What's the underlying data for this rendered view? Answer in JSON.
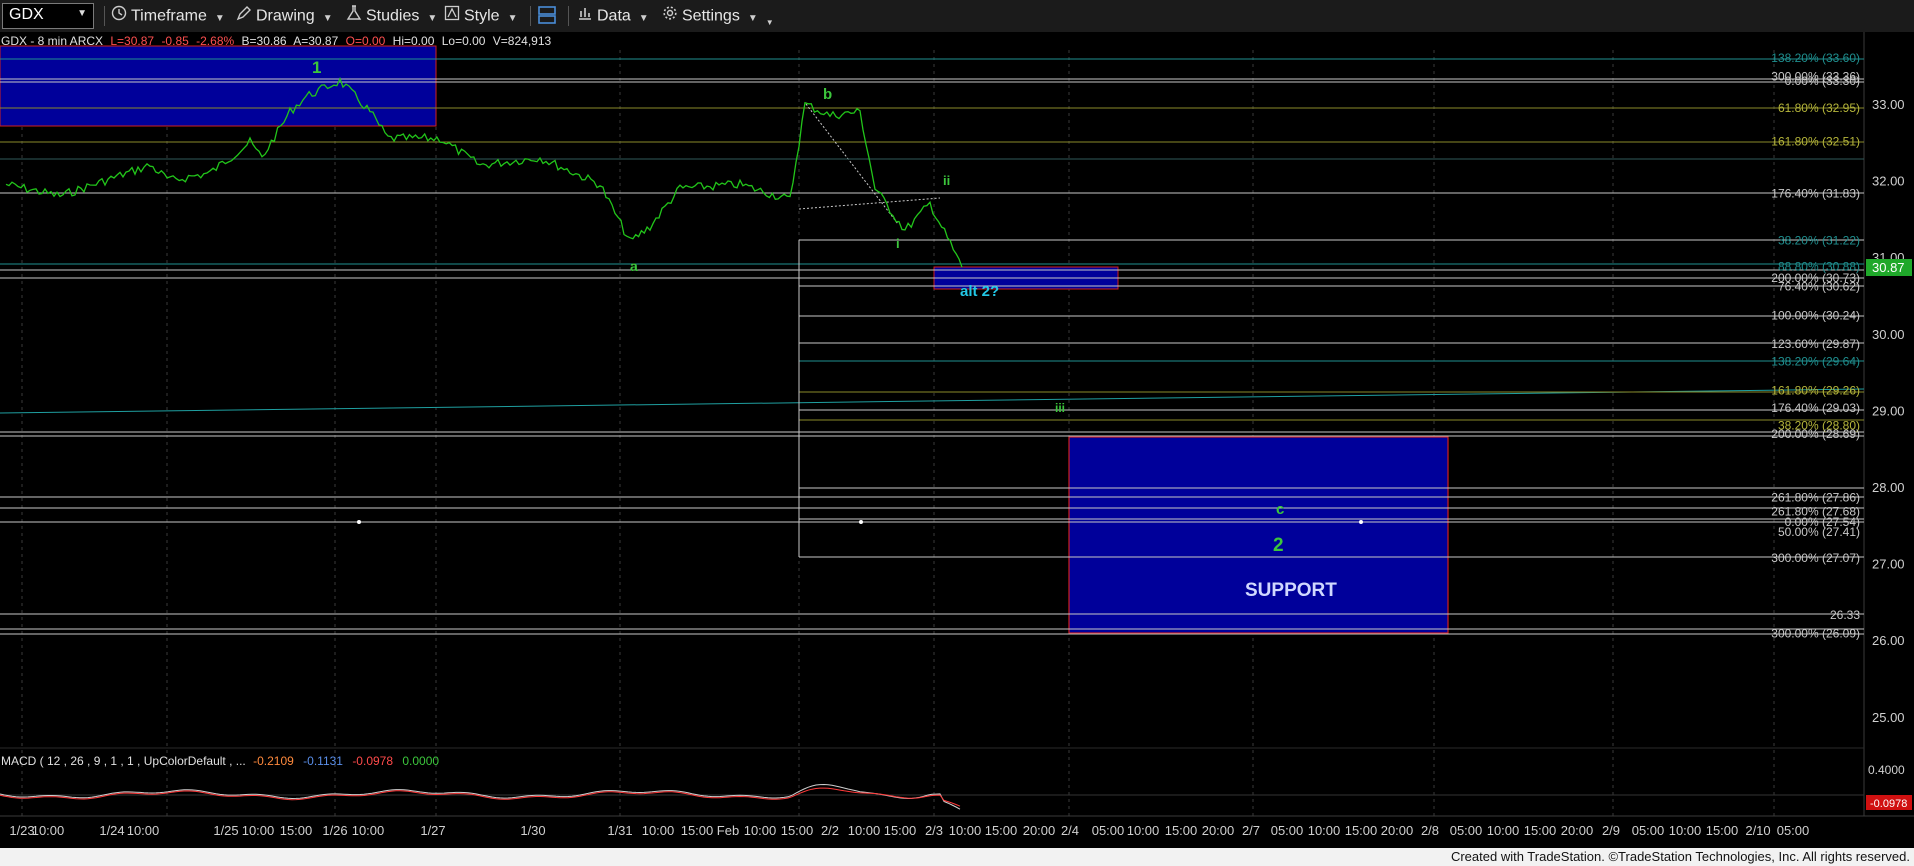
{
  "toolbar": {
    "symbol": "GDX",
    "items": [
      "Timeframe",
      "Drawing",
      "Studies",
      "Style",
      "Data",
      "Settings"
    ]
  },
  "header": {
    "symbol_info": "GDX - 8 min  ARCX",
    "last": "L=30.87",
    "change": "-0.85",
    "change_pct": "-2.68%",
    "bid": "B=30.86",
    "ask": "A=30.87",
    "open": "O=0.00",
    "hi": "Hi=0.00",
    "lo": "Lo=0.00",
    "vol": "V=824,913"
  },
  "colors": {
    "price_line": "#22c51a",
    "bid_color": "#ff4a4a",
    "last_badge": "#1fa82a",
    "box_blue": "#00009a",
    "box_border": "#d02020",
    "wave_label": "#3cc63c",
    "alt_label": "#22c8e6"
  },
  "price_axis": {
    "ticks": [
      "33.00",
      "32.00",
      "31.00",
      "30.00",
      "29.00",
      "28.00",
      "27.00",
      "26.00",
      "25.00"
    ],
    "last_price": "30.87"
  },
  "time_axis": {
    "labels": [
      "1/23",
      "10:00",
      "1/24",
      "10:00",
      "1/25",
      "10:00",
      "15:00",
      "1/26",
      "10:00",
      "1/27",
      "1/30",
      "1/31",
      "10:00",
      "15:00",
      "Feb",
      "10:00",
      "15:00",
      "2/2",
      "10:00",
      "15:00",
      "2/3",
      "10:00",
      "15:00",
      "20:00",
      "2/4",
      "05:00",
      "10:00",
      "15:00",
      "20:00",
      "2/7",
      "05:00",
      "10:00",
      "15:00",
      "20:00",
      "2/8",
      "05:00",
      "10:00",
      "15:00",
      "20:00",
      "2/9",
      "05:00",
      "10:00",
      "15:00",
      "2/10",
      "05:00"
    ]
  },
  "fib_labels": [
    {
      "text": "138.20% (33.60)",
      "color": "#1f8f8f"
    },
    {
      "text": "300.00% (33.36)",
      "color": "#c8c8c8"
    },
    {
      "text": "0.00% (33.30)",
      "color": "#c8c8c8"
    },
    {
      "text": "61.80% (32.95)",
      "color": "#b5b53a"
    },
    {
      "text": "161.80% (32.51)",
      "color": "#b5b53a"
    },
    {
      "text": "176.40% (31.83)",
      "color": "#c8c8c8"
    },
    {
      "text": "38.20% (31.22)",
      "color": "#1f8f8f"
    },
    {
      "text": "88.80% (30.88)",
      "color": "#1f8f8f"
    },
    {
      "text": "200.00% (30.73)",
      "color": "#c8c8c8"
    },
    {
      "text": "76.40% (30.62)",
      "color": "#c8c8c8"
    },
    {
      "text": "100.00% (30.24)",
      "color": "#c8c8c8"
    },
    {
      "text": "123.60% (29.87)",
      "color": "#c8c8c8"
    },
    {
      "text": "138.20% (29.64)",
      "color": "#1f8f8f"
    },
    {
      "text": "161.80% (29.26)",
      "color": "#b5b53a"
    },
    {
      "text": "176.40% (29.03)",
      "color": "#c8c8c8"
    },
    {
      "text": "38.20% (28.80)",
      "color": "#b5b53a"
    },
    {
      "text": "200.00% (28.69)",
      "color": "#c8c8c8"
    },
    {
      "text": "261.80% (27.86)",
      "color": "#c8c8c8"
    },
    {
      "text": "261.80% (27.68)",
      "color": "#c8c8c8"
    },
    {
      "text": "0.00% (27.54)",
      "color": "#c8c8c8"
    },
    {
      "text": "50.00% (27.41)",
      "color": "#c8c8c8"
    },
    {
      "text": "300.00% (27.07)",
      "color": "#c8c8c8"
    },
    {
      "text": "26.33",
      "color": "#c8c8c8"
    },
    {
      "text": "300.00% (26.09)",
      "color": "#c8c8c8"
    }
  ],
  "wave_labels": {
    "w1": "1",
    "a": "a",
    "b": "b",
    "i": "i",
    "ii": "ii",
    "iii": "iii",
    "c": "c",
    "w2": "2",
    "alt": "alt 2?",
    "support": "SUPPORT"
  },
  "macd": {
    "label": "MACD ( 12 , 26 , 9 , 1 , 1 , UpColorDefault , ...",
    "v1": "-0.2109",
    "v2": "-0.1131",
    "v3": "-0.0978",
    "v4": "0.0000",
    "axis_top": "0.4000",
    "axis_bottom": "-0.0978"
  },
  "footer": "Created with TradeStation. ©TradeStation Technologies, Inc. All rights reserved.",
  "chart_data": {
    "type": "line",
    "symbol": "GDX",
    "ylim": [
      24.6,
      34.0
    ],
    "y_ticks": [
      25,
      26,
      27,
      28,
      29,
      30,
      31,
      32,
      33
    ],
    "price_path": [
      {
        "x": "1/23 09:30",
        "y": 31.95
      },
      {
        "x": "1/23 12:00",
        "y": 31.8
      },
      {
        "x": "1/23 15:00",
        "y": 32.2
      },
      {
        "x": "1/24 10:00",
        "y": 32.0
      },
      {
        "x": "1/24 13:00",
        "y": 32.1
      },
      {
        "x": "1/24 15:00",
        "y": 32.5
      },
      {
        "x": "1/25 10:00",
        "y": 32.3
      },
      {
        "x": "1/25 13:00",
        "y": 32.9
      },
      {
        "x": "1/25 15:00",
        "y": 33.1
      },
      {
        "x": "1/26 10:00",
        "y": 33.3
      },
      {
        "x": "1/26 13:00",
        "y": 32.9
      },
      {
        "x": "1/26 15:00",
        "y": 32.55
      },
      {
        "x": "1/27 10:00",
        "y": 32.55
      },
      {
        "x": "1/27 15:00",
        "y": 32.2
      },
      {
        "x": "1/30 10:00",
        "y": 32.3
      },
      {
        "x": "1/30 15:00",
        "y": 31.95
      },
      {
        "x": "1/31 10:00",
        "y": 31.2
      },
      {
        "x": "1/31 12:00",
        "y": 31.4
      },
      {
        "x": "1/31 15:00",
        "y": 31.9
      },
      {
        "x": "Feb 10:00",
        "y": 31.95
      },
      {
        "x": "Feb 15:00",
        "y": 31.75
      },
      {
        "x": "2/2 09:30",
        "y": 33.0
      },
      {
        "x": "2/2 10:00",
        "y": 32.85
      },
      {
        "x": "2/2 11:00",
        "y": 32.9
      },
      {
        "x": "2/2 12:00",
        "y": 31.9
      },
      {
        "x": "2/2 15:00",
        "y": 31.35
      },
      {
        "x": "2/3 09:30",
        "y": 31.7
      },
      {
        "x": "2/3 10:00",
        "y": 30.87
      }
    ]
  }
}
